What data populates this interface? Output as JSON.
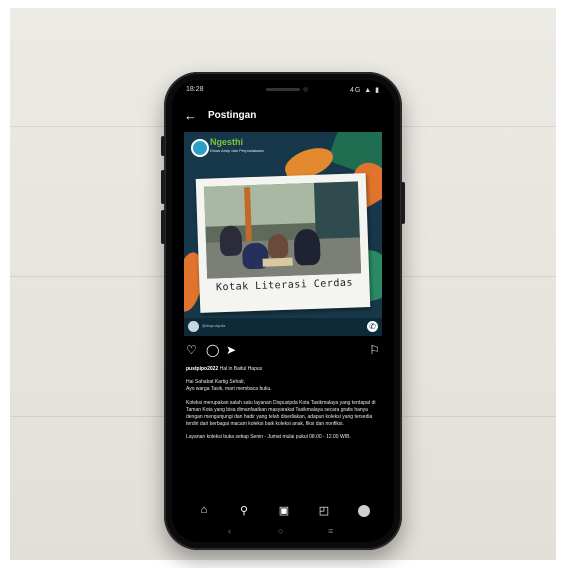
{
  "status_bar": {
    "time": "18:28",
    "indicators": "4G ▲ ▮"
  },
  "header": {
    "back_icon": "back-arrow-icon",
    "title": "Postingan"
  },
  "post": {
    "logo_text": "Ngesthi",
    "logo_subtitle": "Dinas Arsip dan Perpustakaan",
    "photo_caption": "Kotak Literasi Cerdas",
    "footer_text": "@dispusipda",
    "actions": [
      "like-icon",
      "comment-icon",
      "share-icon",
      "save-icon"
    ],
    "username": "pustpipo2022",
    "username_suffix": "Hal in Baitul Hapus",
    "paragraphs": [
      "Hai Sahabat Kartig Sehati,\nAyo warga Tasik, mari membaca buku.",
      "Koleksi merupakan salah satu layanan Dispusipda Kota Tasikmalaya yang terdapat di Taman Kota yang bisa dimanfaatkan masyarakat Tasikmalaya secara gratis hanya dengan mengunjungi dan hadir yang telah disediakan, adapun koleksi yang tersedia terdiri dari berbagai macam koleksi baik koleksi anak, fiksi dan nonfiksi.",
      "Layanan koleksi buka setiap Senin - Jumat mulai pukul 08.00 - 12.00 WIB."
    ]
  },
  "bottom_nav": [
    "home-icon",
    "search-icon",
    "reels-icon",
    "shop-icon",
    "profile-avatar"
  ],
  "system_nav": {
    "back": "‹",
    "home": "○",
    "recent": "≡"
  },
  "colors": {
    "screen_bg": "#000000",
    "post_bg": "#17384a",
    "accent_green": "#7ec242"
  }
}
